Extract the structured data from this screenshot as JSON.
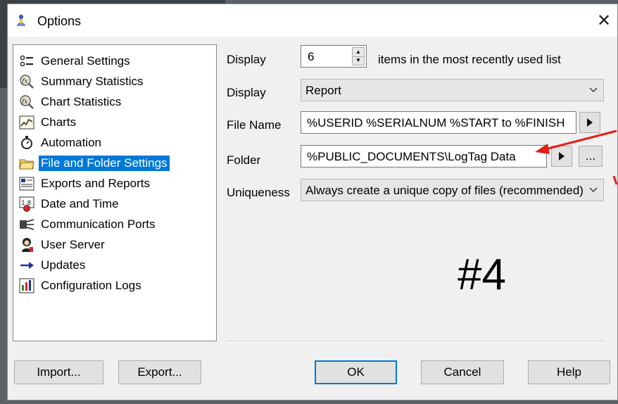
{
  "window": {
    "title": "Options",
    "close_glyph": "✕",
    "app_icon": "person-icon"
  },
  "tree": {
    "items": [
      {
        "label": "General Settings",
        "icon": "settings-list-icon"
      },
      {
        "label": "Summary Statistics",
        "icon": "fx-magnifier-icon"
      },
      {
        "label": "Chart Statistics",
        "icon": "fx-magnifier-icon"
      },
      {
        "label": "Charts",
        "icon": "line-chart-icon"
      },
      {
        "label": "Automation",
        "icon": "stopwatch-icon"
      },
      {
        "label": "File and Folder Settings",
        "icon": "folder-icon",
        "selected": true
      },
      {
        "label": "Exports and Reports",
        "icon": "report-icon"
      },
      {
        "label": "Date and Time",
        "icon": "calendar-clock-icon"
      },
      {
        "label": "Communication Ports",
        "icon": "ports-icon"
      },
      {
        "label": "User Server",
        "icon": "user-server-icon"
      },
      {
        "label": "Updates",
        "icon": "arrow-right-icon"
      },
      {
        "label": "Configuration Logs",
        "icon": "config-log-icon"
      }
    ]
  },
  "form": {
    "display_label_1": "Display",
    "mru_count": "6",
    "mru_suffix": "items in the most recently used list",
    "display_label_2": "Display",
    "display_value": "Report",
    "filename_label": "File Name",
    "filename_value": "%USERID %SERIALNUM %START to %FINISH",
    "folder_label": "Folder",
    "folder_value": "%PUBLIC_DOCUMENTS\\LogTag Data",
    "browse_label": "...",
    "uniqueness_label": "Uniqueness",
    "uniqueness_value": "Always create a unique copy of files (recommended)"
  },
  "annotation": {
    "text": "#4",
    "arrow_color": "#e0201b"
  },
  "buttons": {
    "import": "Import...",
    "export": "Export...",
    "ok": "OK",
    "cancel": "Cancel",
    "help": "Help"
  },
  "colors": {
    "selection": "#0078d7",
    "focus_border": "#0078d7"
  }
}
